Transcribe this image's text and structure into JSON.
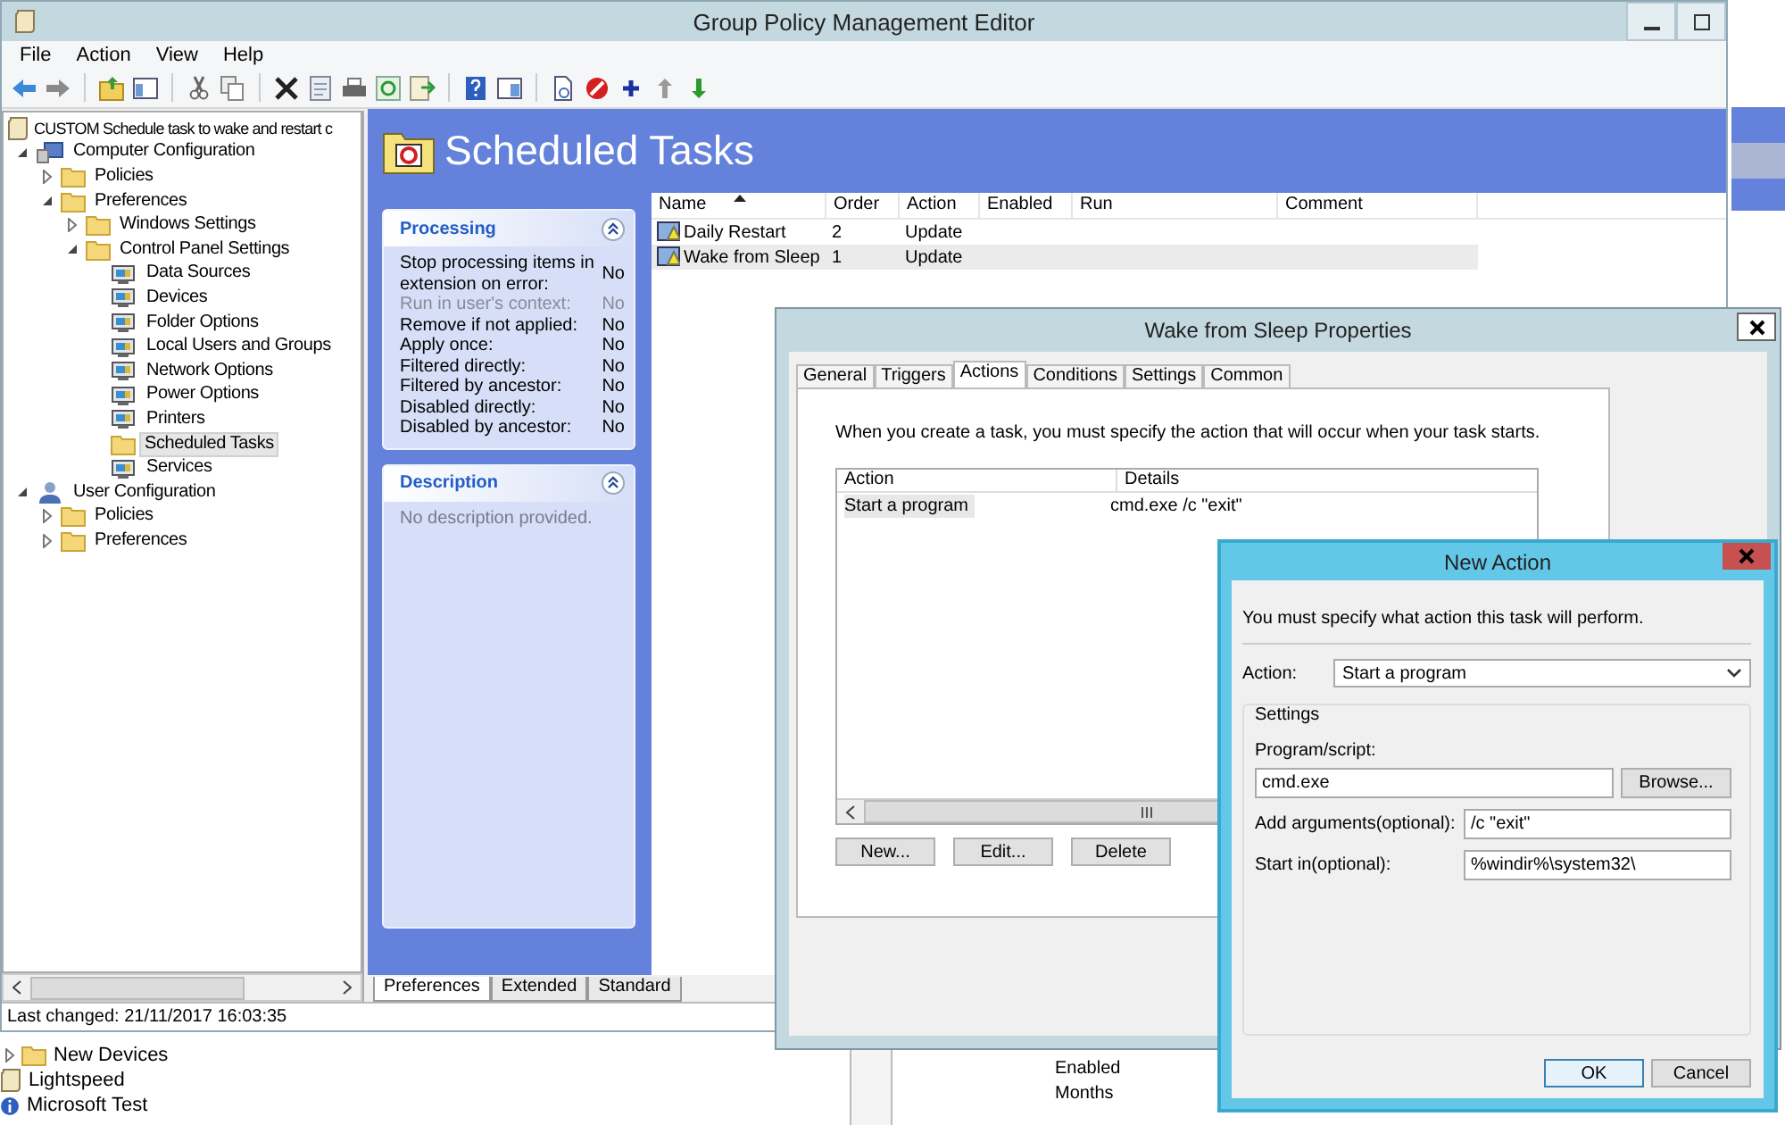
{
  "window": {
    "title": "Group Policy Management Editor"
  },
  "menu": [
    "File",
    "Action",
    "View",
    "Help"
  ],
  "tree": [
    {
      "label": "CUSTOM Schedule task to wake and restart c",
      "kind": "root",
      "selected": false,
      "children": [
        {
          "label": "Computer Configuration",
          "kind": "computer",
          "expanded": true,
          "selected": false,
          "children": [
            {
              "label": "Policies",
              "kind": "folder",
              "expanded": false,
              "selected": false
            },
            {
              "label": "Preferences",
              "kind": "folder",
              "expanded": true,
              "selected": false,
              "children": [
                {
                  "label": "Windows Settings",
                  "kind": "folder",
                  "expanded": false,
                  "selected": false
                },
                {
                  "label": "Control Panel Settings",
                  "kind": "folder",
                  "expanded": true,
                  "selected": false,
                  "children": [
                    {
                      "label": "Data Sources",
                      "kind": "item",
                      "selected": false
                    },
                    {
                      "label": "Devices",
                      "kind": "item",
                      "selected": false
                    },
                    {
                      "label": "Folder Options",
                      "kind": "item",
                      "selected": false
                    },
                    {
                      "label": "Local Users and Groups",
                      "kind": "item",
                      "selected": false
                    },
                    {
                      "label": "Network Options",
                      "kind": "item",
                      "selected": false
                    },
                    {
                      "label": "Power Options",
                      "kind": "item",
                      "selected": false
                    },
                    {
                      "label": "Printers",
                      "kind": "item",
                      "selected": false
                    },
                    {
                      "label": "Scheduled Tasks",
                      "kind": "folder",
                      "selected": true
                    },
                    {
                      "label": "Services",
                      "kind": "item",
                      "selected": false
                    }
                  ]
                }
              ]
            }
          ]
        },
        {
          "label": "User Configuration",
          "kind": "user",
          "expanded": true,
          "selected": false,
          "children": [
            {
              "label": "Policies",
              "kind": "folder",
              "expanded": false,
              "selected": false
            },
            {
              "label": "Preferences",
              "kind": "folder",
              "expanded": false,
              "selected": false
            }
          ]
        }
      ]
    }
  ],
  "pane": {
    "title": "Scheduled Tasks",
    "processing": {
      "title": "Processing",
      "rows": [
        {
          "label": "Stop processing items in extension on error:",
          "value": "No",
          "disabled": false
        },
        {
          "label": "Run in user's context:",
          "value": "No",
          "disabled": true
        },
        {
          "label": "Remove if not applied:",
          "value": "No",
          "disabled": false
        },
        {
          "label": "Apply once:",
          "value": "No",
          "disabled": false
        },
        {
          "label": "Filtered directly:",
          "value": "No",
          "disabled": false
        },
        {
          "label": "Filtered by ancestor:",
          "value": "No",
          "disabled": false
        },
        {
          "label": "Disabled directly:",
          "value": "No",
          "disabled": false
        },
        {
          "label": "Disabled by ancestor:",
          "value": "No",
          "disabled": false
        }
      ]
    },
    "description": {
      "title": "Description",
      "text": "No description provided."
    },
    "table": {
      "columns": [
        {
          "label": "Name",
          "sorted": true
        },
        {
          "label": "Order",
          "sorted": false
        },
        {
          "label": "Action",
          "sorted": false
        },
        {
          "label": "Enabled",
          "sorted": false
        },
        {
          "label": "Run",
          "sorted": false
        },
        {
          "label": "Comment",
          "sorted": false
        }
      ],
      "rows": [
        {
          "name": "Daily Restart",
          "order": "2",
          "action": "Update",
          "selected": false
        },
        {
          "name": "Wake from Sleep",
          "order": "1",
          "action": "Update",
          "selected": true
        }
      ]
    }
  },
  "bottom_tabs": [
    {
      "label": "Preferences",
      "selected": true
    },
    {
      "label": "Extended",
      "selected": false
    },
    {
      "label": "Standard",
      "selected": false
    }
  ],
  "status_bar": "Last changed: 21/11/2017 16:03:35",
  "background_window": {
    "tree": [
      {
        "label": "New Devices",
        "kind": "folder",
        "expanded": false
      },
      {
        "label": "Lightspeed",
        "kind": "root"
      },
      {
        "label": "Microsoft Test",
        "kind": "info"
      }
    ],
    "values": [
      "Enabled",
      "Months"
    ]
  },
  "properties_dialog": {
    "title": "Wake from Sleep Properties",
    "tabs": [
      {
        "label": "General",
        "selected": false
      },
      {
        "label": "Triggers",
        "selected": false
      },
      {
        "label": "Actions",
        "selected": true
      },
      {
        "label": "Conditions",
        "selected": false
      },
      {
        "label": "Settings",
        "selected": false
      },
      {
        "label": "Common",
        "selected": false
      }
    ],
    "intro": "When you create a task, you must specify the action that will occur when your task starts.",
    "columns": [
      "Action",
      "Details"
    ],
    "rows": [
      {
        "action": "Start a program",
        "details": "cmd.exe /c \"exit\"",
        "selected": true
      }
    ],
    "buttons": [
      "New...",
      "Edit...",
      "Delete"
    ]
  },
  "new_action_dialog": {
    "title": "New Action",
    "intro": "You must specify what action this task will perform.",
    "action_label": "Action:",
    "action_value": "Start a program",
    "settings_title": "Settings",
    "program_label": "Program/script:",
    "program_value": "cmd.exe",
    "browse": "Browse...",
    "arguments_label": "Add arguments(optional):",
    "arguments_value": "/c \"exit\"",
    "start_in_label": "Start in(optional):",
    "start_in_value": "%windir%\\system32\\",
    "buttons": [
      "OK",
      "Cancel"
    ]
  }
}
